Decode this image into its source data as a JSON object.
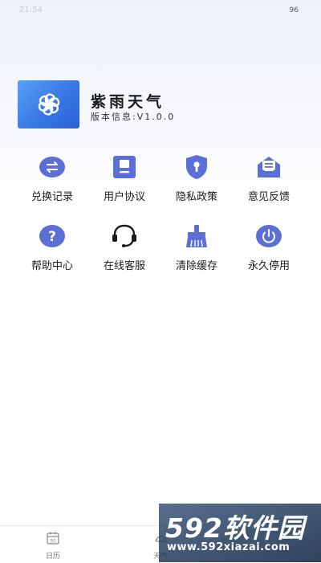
{
  "status_bar": {
    "time": "21:54",
    "battery": "96"
  },
  "app": {
    "name": "紫雨天气",
    "version": "版本信息:V1.0.0",
    "logo_icon": "flower-logo-icon"
  },
  "menu": [
    {
      "label": "兑换记录",
      "icon": "exchange-icon"
    },
    {
      "label": "用户协议",
      "icon": "document-icon"
    },
    {
      "label": "隐私政策",
      "icon": "shield-icon"
    },
    {
      "label": "意见反馈",
      "icon": "feedback-icon"
    },
    {
      "label": "帮助中心",
      "icon": "help-icon"
    },
    {
      "label": "在线客服",
      "icon": "headset-icon"
    },
    {
      "label": "清除缓存",
      "icon": "broom-icon"
    },
    {
      "label": "永久停用",
      "icon": "power-icon"
    }
  ],
  "bottom_nav": {
    "items": [
      {
        "label": "日历",
        "icon": "calendar-icon",
        "badge": "30"
      },
      {
        "label": "天气",
        "icon": "weather-icon"
      }
    ]
  },
  "watermark": {
    "brand": "592软件园",
    "url": "www.592xiazai.com"
  },
  "colors": {
    "accent": "#5b6fd6",
    "logo_gradient_start": "#5aa2f3",
    "logo_gradient_end": "#2a5fd6"
  }
}
